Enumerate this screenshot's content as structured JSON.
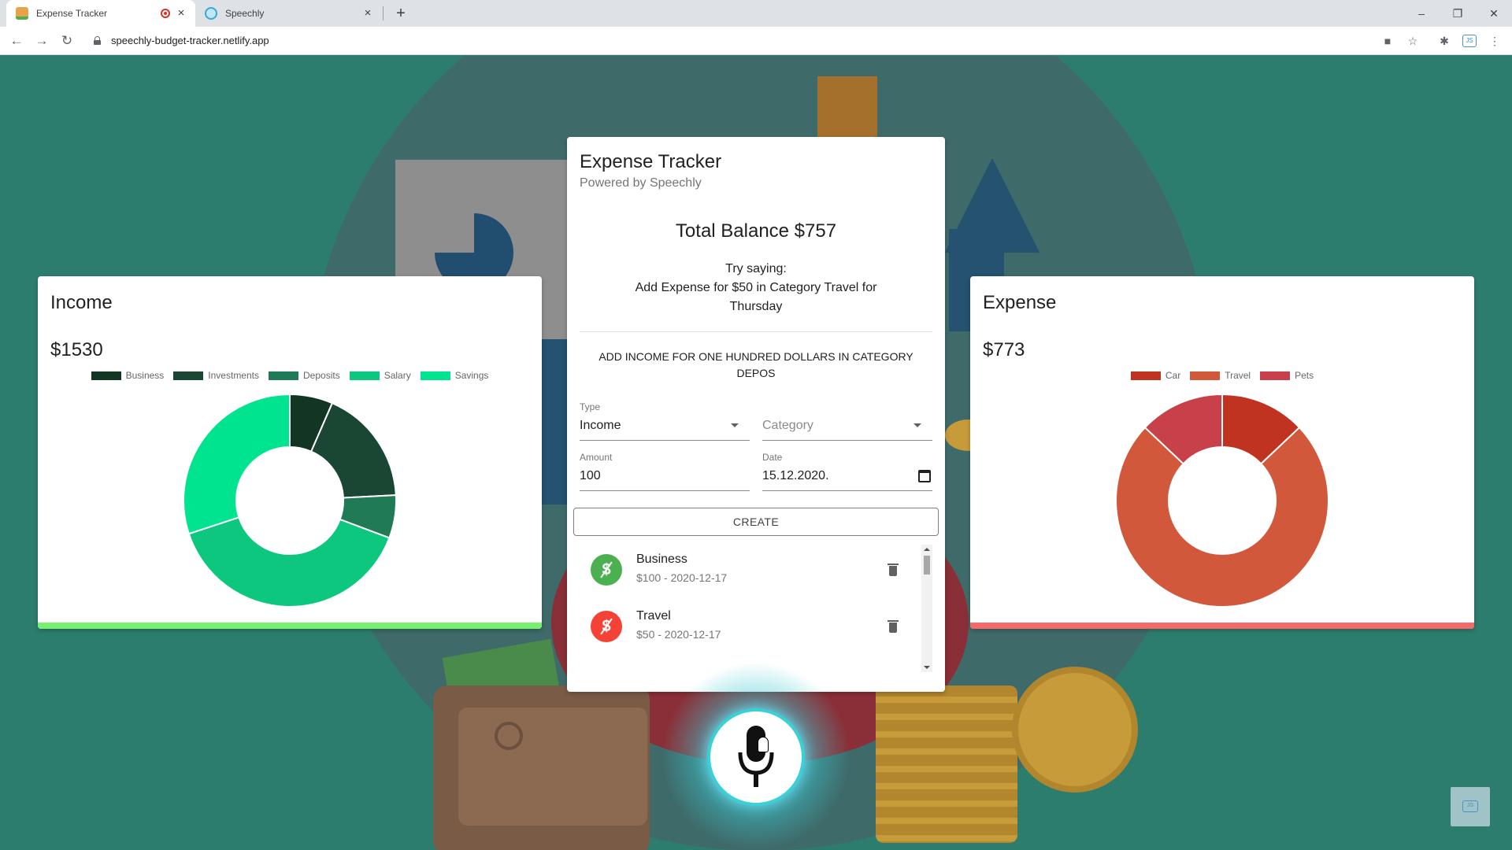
{
  "browser": {
    "tabs": [
      {
        "title": "Expense Tracker",
        "active": true,
        "recording": true
      },
      {
        "title": "Speechly",
        "active": false
      }
    ],
    "url": "speechly-budget-tracker.netlify.app",
    "icons": [
      "back-arrow-icon",
      "forward-arrow-icon",
      "reload-icon",
      "lock-icon",
      "camera-icon",
      "star-icon",
      "puzzle-icon",
      "extension-js-icon",
      "kebab-menu-icon"
    ]
  },
  "income": {
    "title": "Income",
    "amount": "$1530",
    "accent_color": "#76f06e"
  },
  "expense": {
    "title": "Expense",
    "amount": "$773",
    "accent_color": "#f46a6a"
  },
  "main": {
    "title": "Expense Tracker",
    "subtitle": "Powered by Speechly",
    "balance": "Total Balance $757",
    "try_line1": "Try saying:",
    "try_line2": "Add Expense for $50 in Category Travel for Thursday",
    "transcript": "ADD INCOME FOR ONE HUNDRED DOLLARS IN CATEGORY DEPOS",
    "form": {
      "type_label": "Type",
      "type_value": "Income",
      "category_placeholder": "Category",
      "amount_label": "Amount",
      "amount_value": "100",
      "date_label": "Date",
      "date_value": "15.12.2020."
    },
    "create_label": "CREATE",
    "transactions": [
      {
        "name": "Business",
        "detail": "$100 - 2020-12-17",
        "kind": "income",
        "color": "#4caf50"
      },
      {
        "name": "Travel",
        "detail": "$50 - 2020-12-17",
        "kind": "expense",
        "color": "#f44336"
      }
    ]
  },
  "chart_data": [
    {
      "type": "pie",
      "title": "Income",
      "categories": [
        "Business",
        "Investments",
        "Deposits",
        "Salary",
        "Savings"
      ],
      "values": [
        100,
        270,
        100,
        600,
        460
      ],
      "colors": [
        "#123524",
        "#1a4733",
        "#1f7a55",
        "#0dc77f",
        "#00e38f"
      ],
      "legend": "top"
    },
    {
      "type": "pie",
      "title": "Expense",
      "categories": [
        "Car",
        "Travel",
        "Pets"
      ],
      "values": [
        100,
        573,
        100
      ],
      "colors": [
        "#c13321",
        "#d2583b",
        "#c8404a"
      ],
      "legend": "top"
    }
  ]
}
